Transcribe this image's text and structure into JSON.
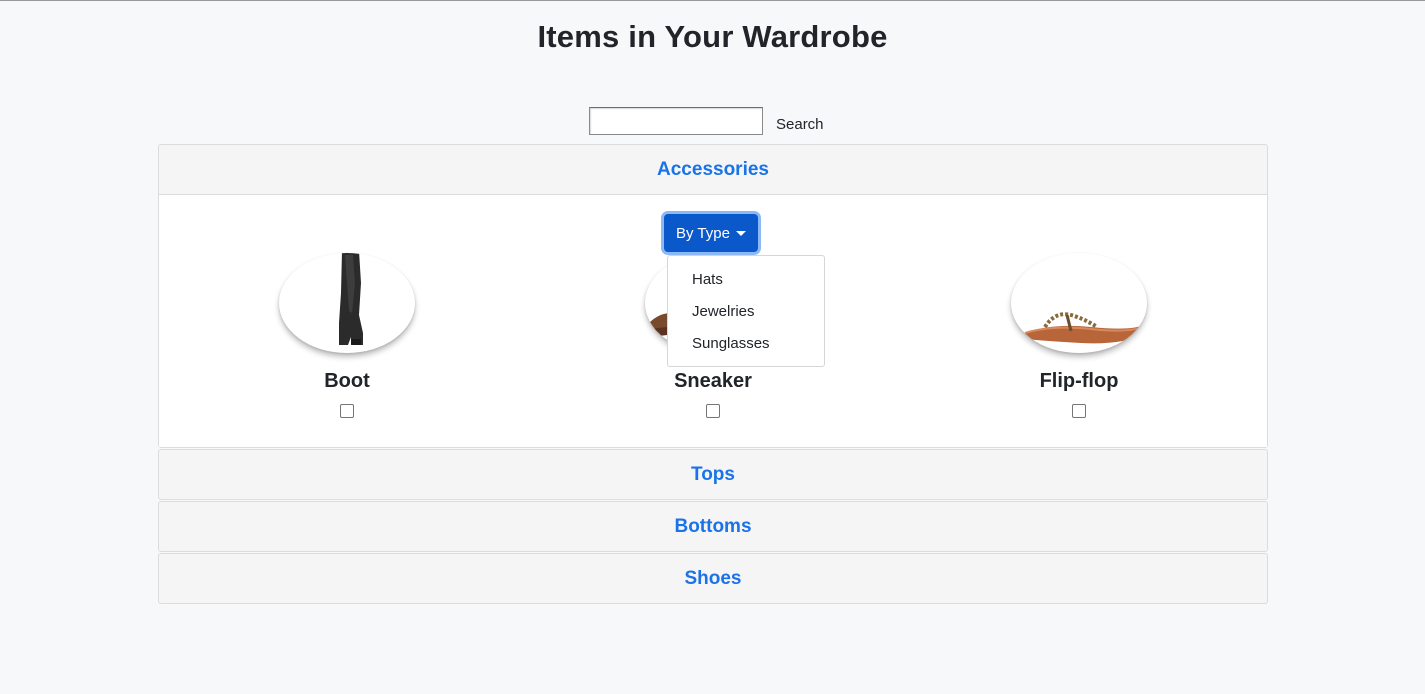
{
  "page": {
    "title": "Items in Your Wardrobe"
  },
  "search": {
    "value": "",
    "label": "Search"
  },
  "categories": [
    {
      "label": "Accessories",
      "open": true
    },
    {
      "label": "Tops",
      "open": false
    },
    {
      "label": "Bottoms",
      "open": false
    },
    {
      "label": "Shoes",
      "open": false
    }
  ],
  "filter": {
    "button_label": "By Type",
    "options": [
      "Hats",
      "Jewelries",
      "Sunglasses"
    ]
  },
  "items": [
    {
      "name": "Boot",
      "checked": false
    },
    {
      "name": "Sneaker",
      "checked": false
    },
    {
      "name": "Flip-flop",
      "checked": false
    }
  ],
  "colors": {
    "accent": "#1a73e8",
    "button": "#0a58ca"
  }
}
